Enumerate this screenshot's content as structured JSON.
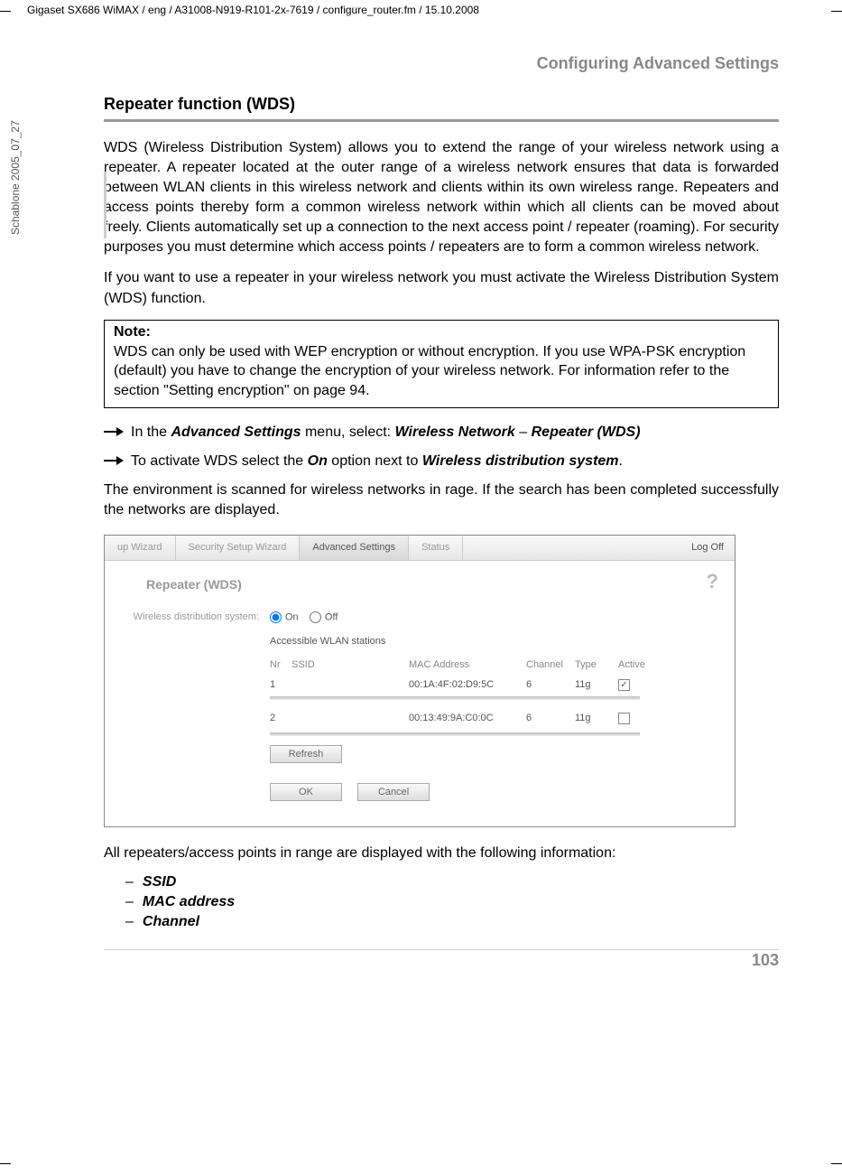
{
  "header": {
    "path": "Gigaset SX686 WiMAX / eng / A31008-N919-R101-2x-7619 / configure_router.fm / 15.10.2008",
    "rotated": "Schablone 2005_07_27"
  },
  "titles": {
    "section": "Configuring Advanced Settings",
    "subsection": "Repeater function (WDS)"
  },
  "paragraphs": {
    "p1": "WDS (Wireless Distribution System) allows you to extend the range of your wireless network using a repeater. A repeater located at the outer range of a wireless network ensures that data is forwarded between WLAN clients in this wireless network and clients within its own wireless range. Repeaters and access points thereby form a common wireless network within which all clients can be moved about freely. Clients automatically set up a connection to the next access point / repeater (roaming). For security purposes you must determine which access points / repeaters are to form a common wireless network.",
    "p2": "If you want to use a repeater in your wireless network you must activate the Wireless Distribution System (WDS) function.",
    "note_label": "Note:",
    "note_text": "WDS can only be used with WEP encryption or without encryption. If you use WPA-PSK encryption (default) you have to change the encryption of your wireless network. For information refer to the section \"Setting encryption\" on page 94.",
    "arrow1_pre": "In the ",
    "arrow1_b1": "Advanced Settings",
    "arrow1_mid": " menu, select: ",
    "arrow1_b2": "Wireless Network",
    "arrow1_sep": " – ",
    "arrow1_b3": "Repeater (WDS)",
    "arrow2_pre": "To activate WDS select the ",
    "arrow2_b1": "On",
    "arrow2_mid": " option next to ",
    "arrow2_b2": "Wireless distribution system",
    "arrow2_end": ".",
    "p3": "The environment is scanned for wireless networks in rage. If the search has been completed successfully the networks are displayed.",
    "p4": "All repeaters/access points in range are displayed with the following information:",
    "li1": "SSID",
    "li2": "MAC address",
    "li3": "Channel"
  },
  "screenshot": {
    "tabs": {
      "t1": "up Wizard",
      "t2": "Security Setup Wizard",
      "t3": "Advanced Settings",
      "t4": "Status",
      "logoff": "Log Off"
    },
    "help": "?",
    "title": "Repeater (WDS)",
    "label_wds": "Wireless distribution system:",
    "on": "On",
    "off": "Off",
    "accessible": "Accessible WLAN stations",
    "cols": {
      "nr": "Nr",
      "ssid": "SSID",
      "mac": "MAC Address",
      "channel": "Channel",
      "type": "Type",
      "active": "Active"
    },
    "rows": [
      {
        "nr": "1",
        "ssid": "",
        "mac": "00:1A:4F:02:D9:5C",
        "channel": "6",
        "type": "11g",
        "active": true
      },
      {
        "nr": "2",
        "ssid": "",
        "mac": "00:13:49:9A:C0:0C",
        "channel": "6",
        "type": "11g",
        "active": false
      }
    ],
    "btn_refresh": "Refresh",
    "btn_ok": "OK",
    "btn_cancel": "Cancel"
  },
  "page_number": "103"
}
